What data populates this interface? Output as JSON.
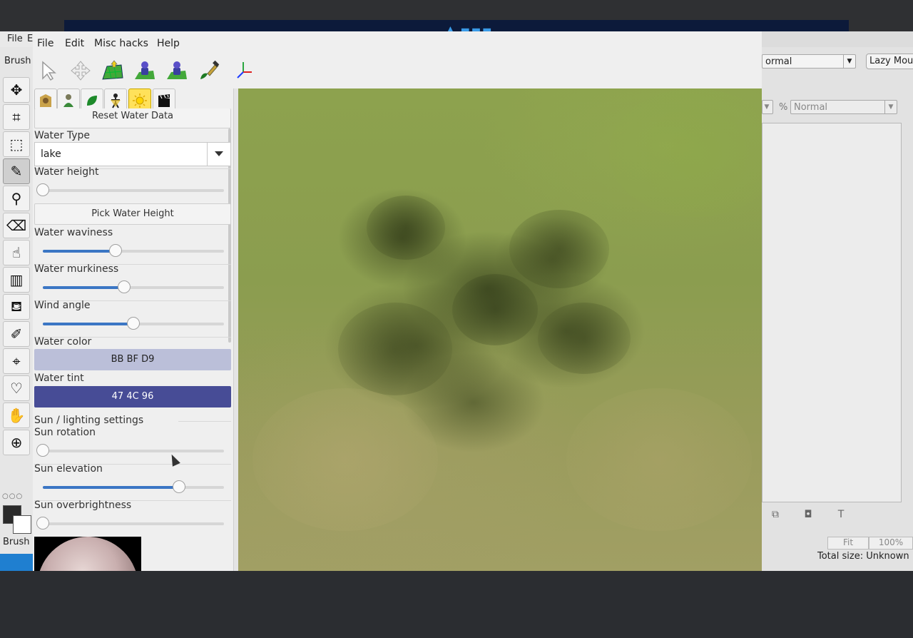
{
  "background_app": {
    "menu": {
      "file": "File",
      "edit": "E"
    },
    "brush_label_top": "Brush",
    "brush_label_bottom": "Brush",
    "right_panel": {
      "blend_mode": "ormal",
      "lazy_mouse": "Lazy Mou",
      "percent_sign": "%",
      "layer_mode": "Normal",
      "fit": "Fit",
      "zoom": "100%",
      "total_size": "Total size: Unknown"
    }
  },
  "menubar": {
    "file": "File",
    "edit": "Edit",
    "misc": "Misc hacks",
    "help": "Help"
  },
  "panel": {
    "reset_water_data": "Reset Water Data",
    "water_type_label": "Water Type",
    "water_type_value": "lake",
    "water_height_label": "Water height",
    "pick_water_height": "Pick Water Height",
    "water_waviness_label": "Water waviness",
    "water_murkiness_label": "Water murkiness",
    "wind_angle_label": "Wind angle",
    "water_color_label": "Water color",
    "water_color_value": "BB BF D9",
    "water_tint_label": "Water tint",
    "water_tint_value": "47 4C 96",
    "sun_section": "Sun / lighting settings",
    "sun_rotation_label": "Sun rotation",
    "sun_elevation_label": "Sun elevation",
    "sun_overbrightness_label": "Sun overbrightness"
  },
  "sliders": {
    "water_height": 0.0,
    "water_waviness": 0.4,
    "water_murkiness": 0.45,
    "wind_angle": 0.5,
    "sun_rotation": 0.0,
    "sun_elevation": 0.75,
    "sun_overbrightness": 0.0
  },
  "colors": {
    "water_color": "#BBBFD9",
    "water_tint": "#474C96",
    "slider_fill": "#3b76c4"
  }
}
